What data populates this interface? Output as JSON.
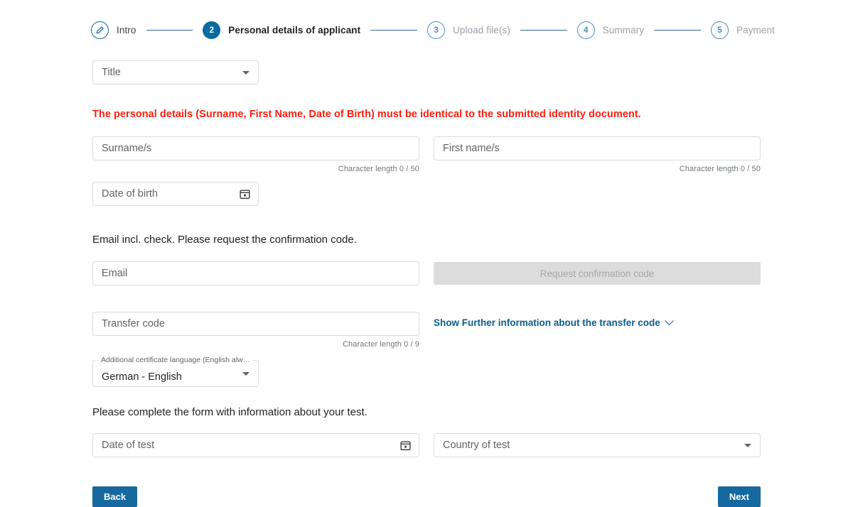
{
  "stepper": {
    "steps": [
      {
        "badge": "pencil-icon",
        "number": "",
        "label": "Intro",
        "state": "done"
      },
      {
        "badge": "number",
        "number": "2",
        "label": "Personal details of applicant",
        "state": "active"
      },
      {
        "badge": "number",
        "number": "3",
        "label": "Upload file(s)",
        "state": "todo"
      },
      {
        "badge": "number",
        "number": "4",
        "label": "Summary",
        "state": "todo"
      },
      {
        "badge": "number",
        "number": "5",
        "label": "Payment",
        "state": "todo"
      }
    ]
  },
  "form": {
    "title_select": {
      "placeholder": "Title",
      "value": ""
    },
    "identity_warning": "The personal details (Surname, First Name, Date of Birth) must be identical to the submitted identity document.",
    "surname": {
      "placeholder": "Surname/s",
      "value": "",
      "counter": "Character length 0 / 50"
    },
    "firstname": {
      "placeholder": "First name/s",
      "value": "",
      "counter": "Character length 0 / 50"
    },
    "date_of_birth": {
      "placeholder": "Date of birth",
      "value": ""
    },
    "email_section_text": "Email incl. check. Please request the confirmation code.",
    "email": {
      "placeholder": "Email",
      "value": ""
    },
    "request_code_button": "Request confirmation code",
    "transfer_code": {
      "placeholder": "Transfer code",
      "value": "",
      "counter": "Character length 0 / 9"
    },
    "transfer_info_link": "Show Further information about the transfer code",
    "certificate_language": {
      "label": "Additional certificate language (English alw…",
      "value": "German - English"
    },
    "test_section_text": "Please complete the form with information about your test.",
    "date_of_test": {
      "placeholder": "Date of test",
      "value": ""
    },
    "country_of_test": {
      "placeholder": "Country of test",
      "value": ""
    }
  },
  "footer": {
    "back_label": "Back",
    "next_label": "Next"
  },
  "colors": {
    "accent_blue": "#15699e",
    "step_blue": "#0a6aa1",
    "error_red": "#ff1e0f",
    "link_blue": "#0a5c8f",
    "disabled_gray": "#dcdcdc"
  }
}
